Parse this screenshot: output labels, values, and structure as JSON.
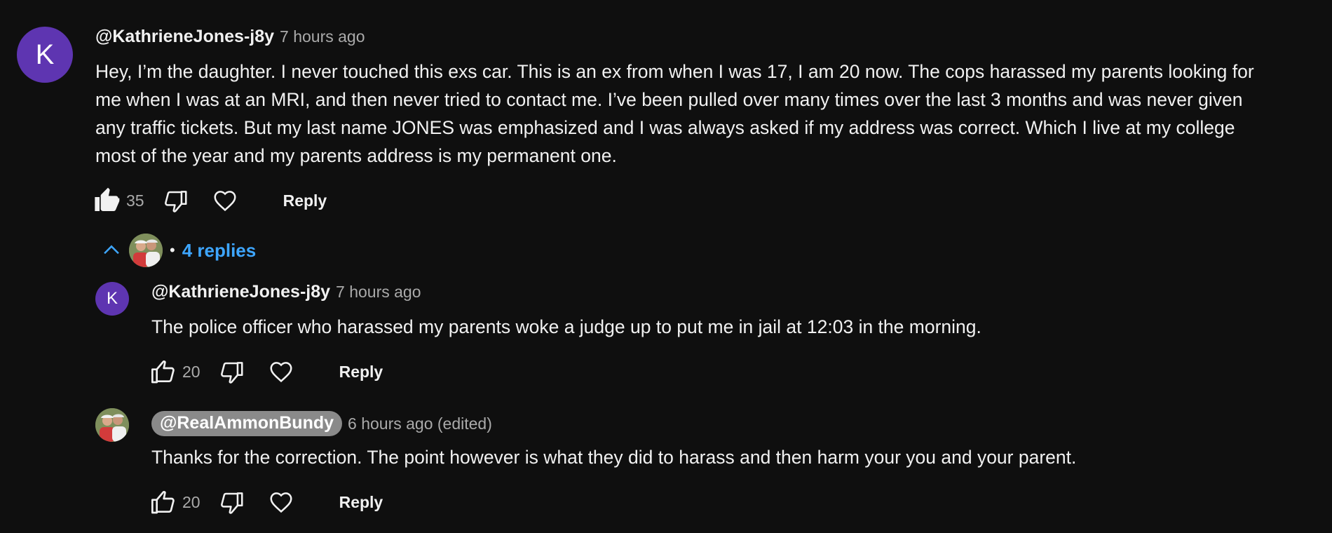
{
  "top_comment": {
    "avatar_letter": "K",
    "author": "@KathrieneJones-j8y",
    "time": "7 hours ago",
    "text_lines": [
      "Hey, I’m the daughter. I never touched this exs car. This is an ex from when I was 17, I am 20 now. The cops harassed my parents looking for",
      "me when I was at an MRI, and then never tried to contact me. I’ve been pulled over many times over the last 3 months and was never given",
      "any traffic tickets. But my last name JONES was emphasized and I was always asked if my address was correct. Which I live at my college",
      "most of the year and my parents address is my permanent one."
    ],
    "likes": "35",
    "reply_label": "Reply",
    "like_state": "liked"
  },
  "replies_toggle": {
    "label": "4 replies",
    "icon": "chevron-up-icon",
    "color": "#3ea6ff"
  },
  "replies": [
    {
      "avatar_letter": "K",
      "author": "@KathrieneJones-j8y",
      "time": "7 hours ago",
      "text": "The police officer who harassed my parents woke a judge up to put me in jail at 12:03 in the morning.",
      "likes": "20",
      "reply_label": "Reply"
    },
    {
      "avatar_photo": true,
      "author": "@RealAmmonBundy",
      "author_is_creator": true,
      "time": "6 hours ago (edited)",
      "text": "Thanks for the correction. The point however is what they did to harass and then harm your you and your parent.",
      "likes": "20",
      "reply_label": "Reply"
    }
  ],
  "colors": {
    "background": "#0f0f0f",
    "text": "#f1f1f1",
    "secondary": "#aaaaaa",
    "avatar": "#5e35b1",
    "link": "#3ea6ff",
    "creator_chip": "#8a8a8a"
  }
}
